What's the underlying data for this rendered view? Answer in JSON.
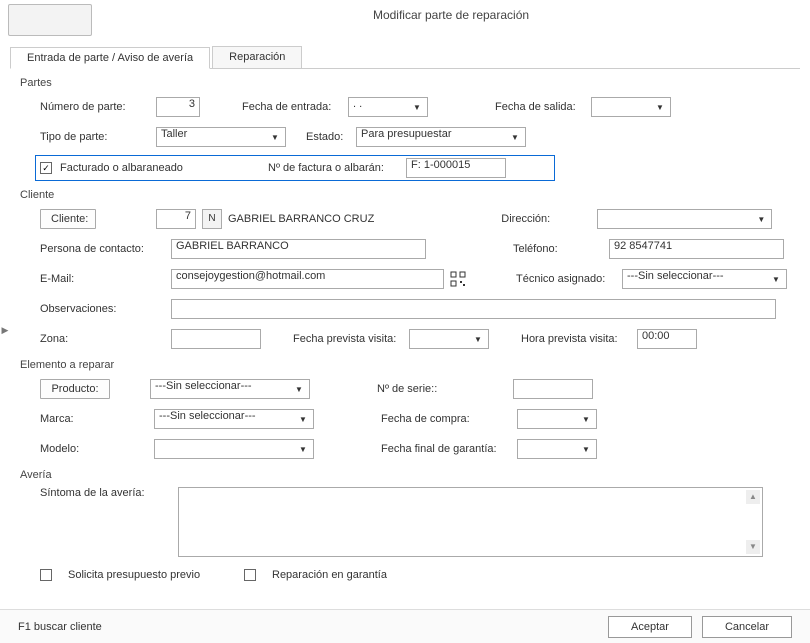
{
  "header": {
    "title": "Modificar parte de reparación"
  },
  "tabs": {
    "entry": "Entrada de parte / Aviso de avería",
    "repair": "Reparación"
  },
  "partes": {
    "title": "Partes",
    "numero_label": "Número de parte:",
    "numero": "3",
    "fecha_entrada_label": "Fecha de entrada:",
    "fecha_entrada": ".       .",
    "fecha_salida_label": "Fecha de salida:",
    "fecha_salida": "",
    "tipo_label": "Tipo de parte:",
    "tipo": "Taller",
    "estado_label": "Estado:",
    "estado": "Para presupuestar",
    "facturado_label": "Facturado o albaraneado",
    "nfact_label": "Nº de factura o albarán:",
    "nfact": "F: 1-000015"
  },
  "cliente": {
    "title": "Cliente",
    "cliente_btn": "Cliente:",
    "cliente_num": "7",
    "n_btn": "N",
    "cliente_name": "GABRIEL BARRANCO CRUZ",
    "direccion_label": "Dirección:",
    "direccion": "",
    "persona_label": "Persona de contacto:",
    "persona": "GABRIEL BARRANCO",
    "telefono_label": "Teléfono:",
    "telefono": "92 8547741",
    "email_label": "E-Mail:",
    "email": "consejoygestion@hotmail.com",
    "tecnico_label": "Técnico asignado:",
    "tecnico": "---Sin seleccionar---",
    "observaciones_label": "Observaciones:",
    "observaciones": "",
    "zona_label": "Zona:",
    "zona": "",
    "fecha_visita_label": "Fecha prevista visita:",
    "fecha_visita": "",
    "hora_visita_label": "Hora prevista visita:",
    "hora_visita": "00:00"
  },
  "elemento": {
    "title": "Elemento a reparar",
    "producto_btn": "Producto:",
    "producto": "---Sin seleccionar---",
    "nserie_label": "Nº de serie::",
    "nserie": "",
    "marca_label": "Marca:",
    "marca": "---Sin seleccionar---",
    "fecha_compra_label": "Fecha de compra:",
    "fecha_compra": "",
    "modelo_label": "Modelo:",
    "modelo": "",
    "fecha_garantia_label": "Fecha final de garantía:",
    "fecha_garantia": ""
  },
  "averia": {
    "title": "Avería",
    "sintoma_label": "Síntoma de la avería:",
    "solicita_label": "Solicita presupuesto previo",
    "garantia_label": "Reparación en garantía"
  },
  "footer": {
    "help": "F1 buscar cliente",
    "accept": "Aceptar",
    "cancel": "Cancelar"
  }
}
